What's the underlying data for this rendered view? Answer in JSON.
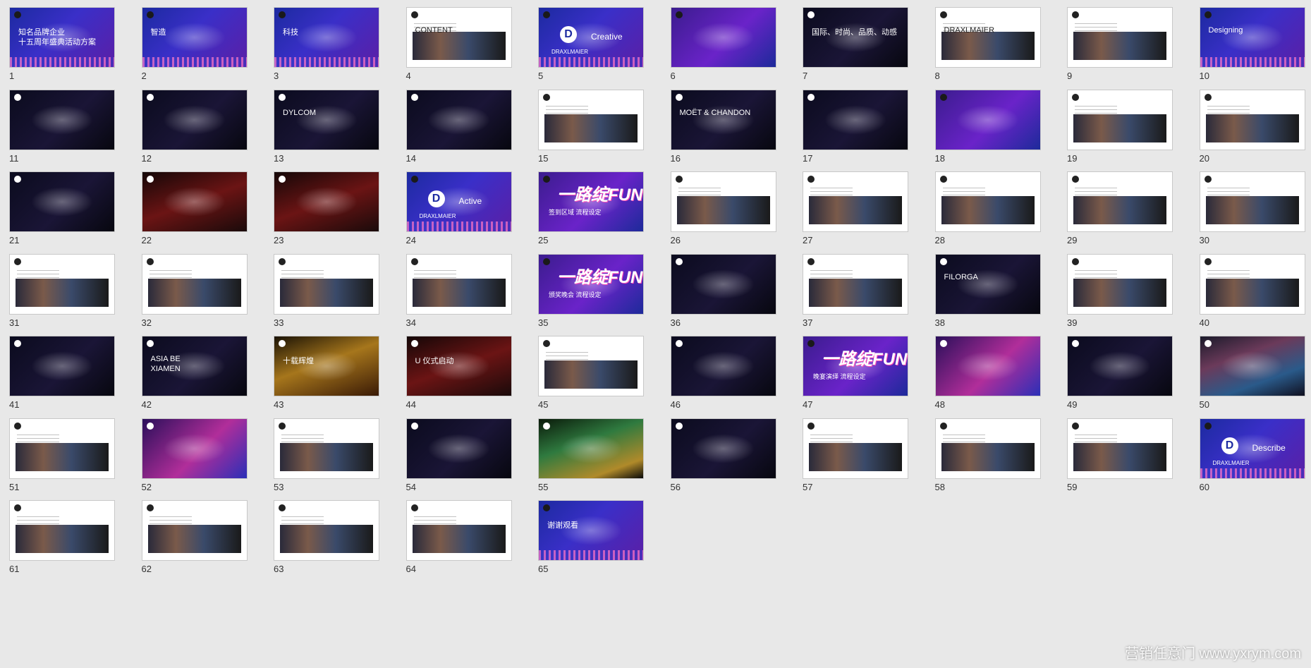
{
  "slides": [
    {
      "n": "1",
      "style": "blue",
      "texts": [
        "知名品牌企业",
        "十五周年盛典活动方案"
      ]
    },
    {
      "n": "2",
      "style": "blue",
      "texts": [
        "智造"
      ]
    },
    {
      "n": "3",
      "style": "blue",
      "texts": [
        "科技"
      ]
    },
    {
      "n": "4",
      "style": "white",
      "texts": [
        "CONTENT"
      ]
    },
    {
      "n": "5",
      "style": "blue",
      "texts": [
        "Creative",
        "DRAXLMAIER"
      ]
    },
    {
      "n": "6",
      "style": "purple",
      "texts": []
    },
    {
      "n": "7",
      "style": "dark",
      "texts": [
        "国际、时尚、品质、动感"
      ]
    },
    {
      "n": "8",
      "style": "white",
      "texts": [
        "DRAXLMAIER"
      ]
    },
    {
      "n": "9",
      "style": "white",
      "texts": []
    },
    {
      "n": "10",
      "style": "blue",
      "texts": [
        "Designing"
      ]
    },
    {
      "n": "11",
      "style": "dark",
      "texts": []
    },
    {
      "n": "12",
      "style": "dark",
      "texts": []
    },
    {
      "n": "13",
      "style": "dark",
      "texts": [
        "DYLCOM"
      ]
    },
    {
      "n": "14",
      "style": "dark",
      "texts": []
    },
    {
      "n": "15",
      "style": "white",
      "texts": []
    },
    {
      "n": "16",
      "style": "dark",
      "texts": [
        "MOËT & CHANDON"
      ]
    },
    {
      "n": "17",
      "style": "dark",
      "texts": []
    },
    {
      "n": "18",
      "style": "purple",
      "texts": []
    },
    {
      "n": "19",
      "style": "white",
      "texts": []
    },
    {
      "n": "20",
      "style": "white",
      "texts": []
    },
    {
      "n": "21",
      "style": "dark",
      "texts": []
    },
    {
      "n": "22",
      "style": "red",
      "texts": []
    },
    {
      "n": "23",
      "style": "red",
      "texts": []
    },
    {
      "n": "24",
      "style": "blue",
      "texts": [
        "Active",
        "DRAXLMAIER"
      ]
    },
    {
      "n": "25",
      "style": "purple",
      "texts": [
        "一路绽FUN",
        "签到区域 流程设定"
      ]
    },
    {
      "n": "26",
      "style": "white",
      "texts": []
    },
    {
      "n": "27",
      "style": "white",
      "texts": []
    },
    {
      "n": "28",
      "style": "white",
      "texts": []
    },
    {
      "n": "29",
      "style": "white",
      "texts": []
    },
    {
      "n": "30",
      "style": "white",
      "texts": []
    },
    {
      "n": "31",
      "style": "white",
      "texts": []
    },
    {
      "n": "32",
      "style": "white",
      "texts": []
    },
    {
      "n": "33",
      "style": "white",
      "texts": []
    },
    {
      "n": "34",
      "style": "white",
      "texts": []
    },
    {
      "n": "35",
      "style": "purple",
      "texts": [
        "一路绽FUN",
        "颁奖晚会 流程设定"
      ]
    },
    {
      "n": "36",
      "style": "dark",
      "texts": []
    },
    {
      "n": "37",
      "style": "white",
      "texts": []
    },
    {
      "n": "38",
      "style": "dark",
      "texts": [
        "FILORGA"
      ]
    },
    {
      "n": "39",
      "style": "white",
      "texts": []
    },
    {
      "n": "40",
      "style": "white",
      "texts": []
    },
    {
      "n": "41",
      "style": "dark",
      "texts": []
    },
    {
      "n": "42",
      "style": "dark",
      "texts": [
        "ASIA BE",
        "XIAMEN"
      ]
    },
    {
      "n": "43",
      "style": "gold",
      "texts": [
        "十载辉煌"
      ]
    },
    {
      "n": "44",
      "style": "red",
      "texts": [
        "U 仪式启动"
      ]
    },
    {
      "n": "45",
      "style": "white",
      "texts": []
    },
    {
      "n": "46",
      "style": "dark",
      "texts": []
    },
    {
      "n": "47",
      "style": "purple",
      "texts": [
        "一路绽FUN",
        "晚宴演绎 流程设定"
      ]
    },
    {
      "n": "48",
      "style": "magenta",
      "texts": []
    },
    {
      "n": "49",
      "style": "dark",
      "texts": []
    },
    {
      "n": "50",
      "style": "photo",
      "texts": []
    },
    {
      "n": "51",
      "style": "white",
      "texts": []
    },
    {
      "n": "52",
      "style": "magenta",
      "texts": []
    },
    {
      "n": "53",
      "style": "white",
      "texts": []
    },
    {
      "n": "54",
      "style": "dark",
      "texts": []
    },
    {
      "n": "55",
      "style": "green",
      "texts": []
    },
    {
      "n": "56",
      "style": "dark",
      "texts": []
    },
    {
      "n": "57",
      "style": "white",
      "texts": []
    },
    {
      "n": "58",
      "style": "white",
      "texts": []
    },
    {
      "n": "59",
      "style": "white",
      "texts": []
    },
    {
      "n": "60",
      "style": "blue",
      "texts": [
        "Describe",
        "DRAXLMAIER"
      ]
    },
    {
      "n": "61",
      "style": "white",
      "texts": []
    },
    {
      "n": "62",
      "style": "white",
      "texts": []
    },
    {
      "n": "63",
      "style": "white",
      "texts": []
    },
    {
      "n": "64",
      "style": "white",
      "texts": []
    },
    {
      "n": "65",
      "style": "blue",
      "texts": [
        "谢谢观看"
      ]
    }
  ],
  "watermark": "营销任意门 www.yxrym.com"
}
